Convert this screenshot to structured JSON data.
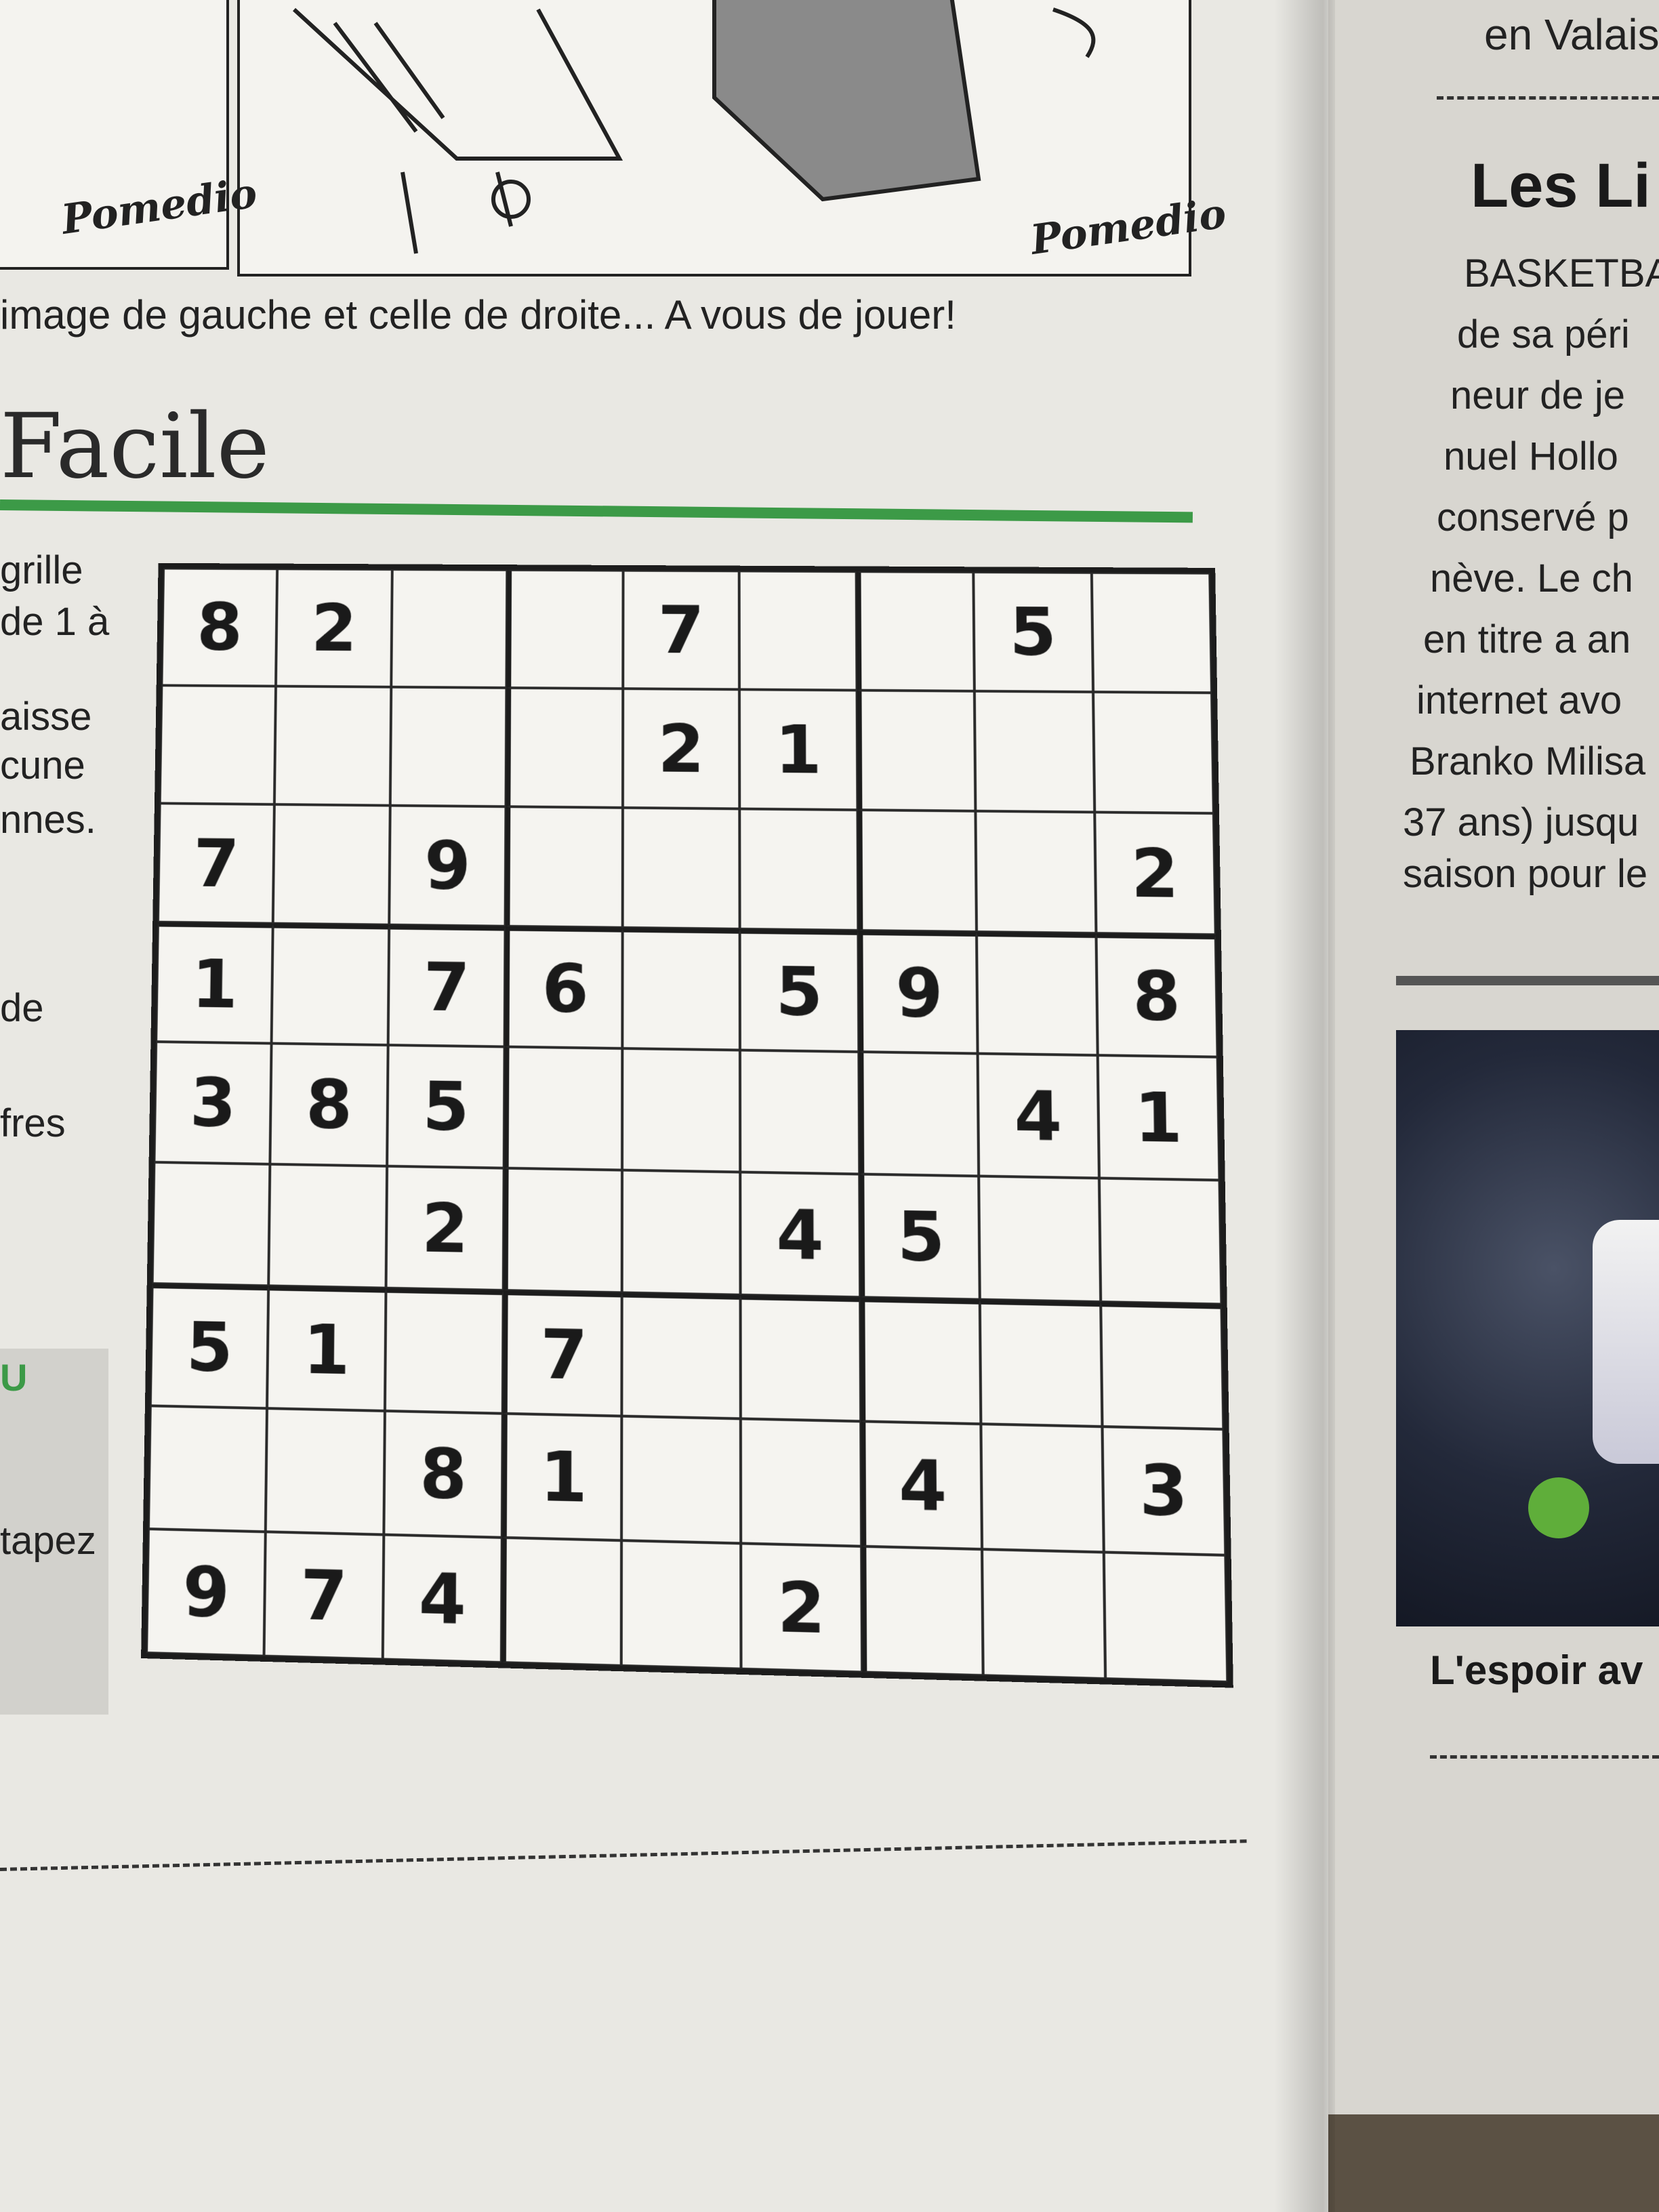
{
  "cartoon": {
    "signature_left": "Pomedio",
    "signature_right": "Pomedio"
  },
  "caption": "image de gauche et celle de droite... A vous de jouer!",
  "puzzle": {
    "difficulty": "Facile",
    "grid": [
      [
        "8",
        "2",
        "",
        "",
        "7",
        "",
        "",
        "5",
        ""
      ],
      [
        "",
        "",
        "",
        "",
        "2",
        "1",
        "",
        "",
        ""
      ],
      [
        "7",
        "",
        "9",
        "",
        "",
        "",
        "",
        "",
        "2"
      ],
      [
        "1",
        "",
        "7",
        "6",
        "",
        "5",
        "9",
        "",
        "8"
      ],
      [
        "3",
        "8",
        "5",
        "",
        "",
        "",
        "",
        "4",
        "1"
      ],
      [
        "",
        "",
        "2",
        "",
        "",
        "4",
        "5",
        "",
        ""
      ],
      [
        "5",
        "1",
        "",
        "7",
        "",
        "",
        "",
        "",
        ""
      ],
      [
        "",
        "",
        "8",
        "1",
        "",
        "",
        "4",
        "",
        "3"
      ],
      [
        "9",
        "7",
        "4",
        "",
        "",
        "2",
        "",
        "",
        ""
      ]
    ]
  },
  "left_column_fragments": [
    "grille",
    "de 1 à",
    "aisse",
    "cune",
    "nnes.",
    "de",
    "fres",
    "U",
    "tapez"
  ],
  "right_column": {
    "top_text": "en Valais",
    "headline": "Les Li",
    "body_lines": [
      "BASKETBA",
      "de sa péri",
      "neur de je",
      "nuel Hollo",
      "conservé p",
      "nève. Le ch",
      "en titre a an",
      "internet avo",
      "Branko Milisa",
      "37 ans) jusqu",
      "saison pour le"
    ],
    "photo_caption": "L'espoir av"
  },
  "colors": {
    "accent_green": "#3c9a47",
    "paper": "#e9e8e3",
    "ink": "#1a1a1a"
  }
}
